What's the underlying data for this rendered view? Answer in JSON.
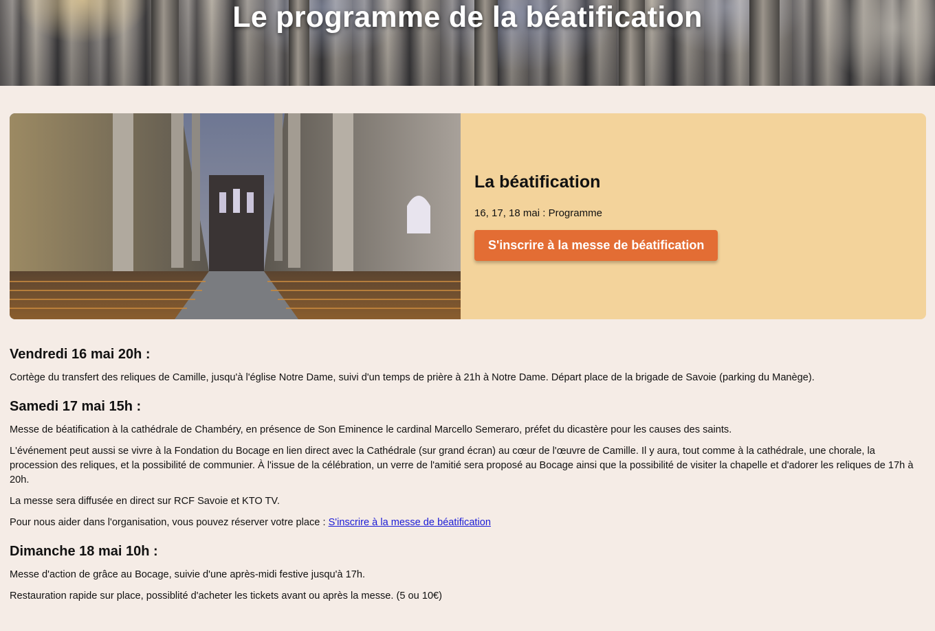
{
  "hero": {
    "title": "Le programme de la béatification"
  },
  "feature": {
    "title": "La béatification",
    "dates": "16, 17, 18 mai : Programme",
    "cta_label": "S'inscrire à la messe de béatification"
  },
  "program": {
    "days": [
      {
        "heading": "Vendredi 16 mai 20h :",
        "paragraphs": [
          "Cortège du transfert des reliques de Camille, jusqu'à l'église Notre Dame, suivi d'un temps de prière à 21h à Notre Dame. Départ place de la brigade de Savoie (parking du Manège)."
        ]
      },
      {
        "heading": "Samedi 17 mai 15h :",
        "paragraphs": [
          "Messe de béatification à la cathédrale de Chambéry, en présence de Son Eminence le cardinal Marcello Semeraro, préfet du dicastère pour les causes des saints.",
          "L'événement peut aussi se vivre à la Fondation du Bocage en lien direct avec la Cathédrale (sur grand écran) au cœur de l'œuvre de Camille. Il y aura, tout comme à la cathédrale, une chorale, la procession des reliques, et la possibilité de communier. À l'issue de la célébration, un verre de l'amitié sera proposé au Bocage ainsi que la possibilité de visiter la chapelle et d'adorer les reliques de 17h à 20h.",
          "La messe sera diffusée en direct sur RCF Savoie et KTO TV."
        ],
        "reserve_text": "Pour nous aider dans l'organisation, vous pouvez réserver votre place : ",
        "reserve_link": "S'inscrire à la messe de béatification"
      },
      {
        "heading": "Dimanche 18 mai 10h :",
        "paragraphs": [
          "Messe d'action de grâce au Bocage, suivie d'une après-midi festive jusqu'à 17h.",
          "Restauration rapide sur place, possiblité d'acheter les tickets avant ou après la messe. (5 ou 10€)"
        ]
      }
    ]
  },
  "colors": {
    "page_bg": "#f5ece6",
    "card_bg": "#f3d39b",
    "cta_bg": "#e36d34",
    "link": "#1a1ad6"
  }
}
